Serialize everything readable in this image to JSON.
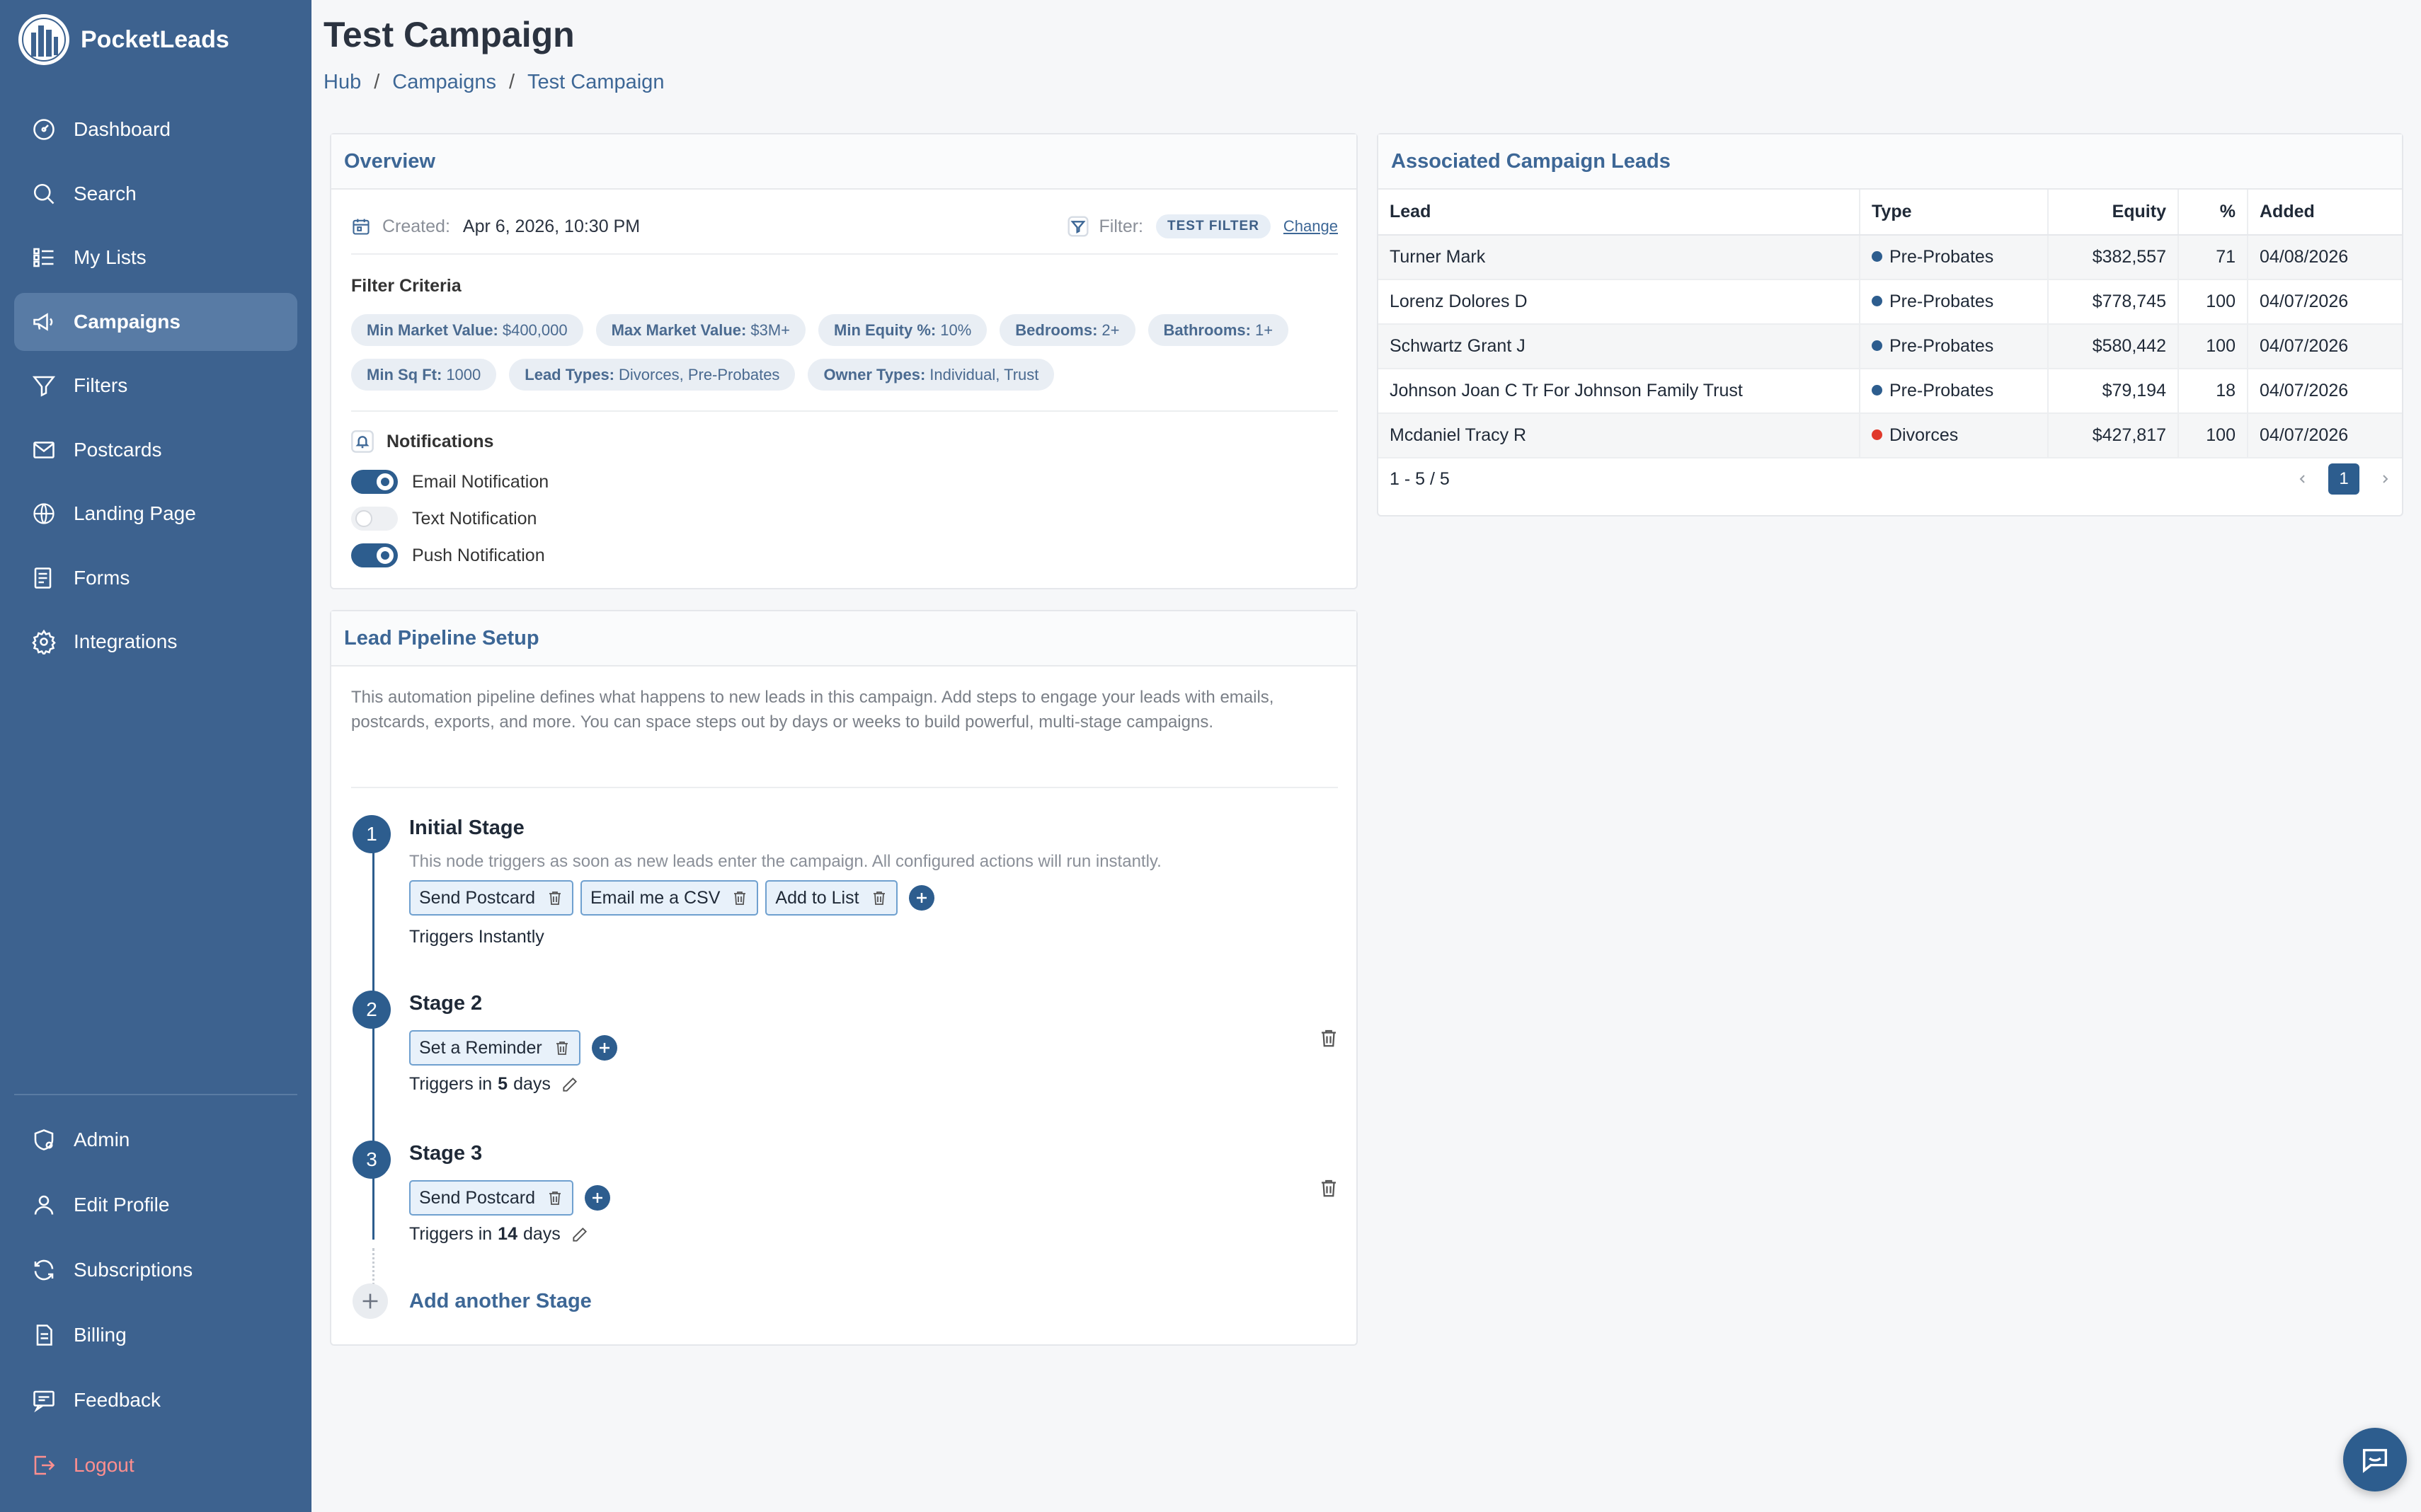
{
  "brand": {
    "name": "PocketLeads"
  },
  "nav": {
    "items": [
      {
        "label": "Dashboard",
        "icon": "dashboard-icon"
      },
      {
        "label": "Search",
        "icon": "search-icon"
      },
      {
        "label": "My Lists",
        "icon": "list-icon"
      },
      {
        "label": "Campaigns",
        "icon": "megaphone-icon",
        "active": true
      },
      {
        "label": "Filters",
        "icon": "filter-icon"
      },
      {
        "label": "Postcards",
        "icon": "envelope-icon"
      },
      {
        "label": "Landing Page",
        "icon": "www-icon"
      },
      {
        "label": "Forms",
        "icon": "form-icon"
      },
      {
        "label": "Integrations",
        "icon": "gear-icon"
      }
    ],
    "bottom": [
      {
        "label": "Admin",
        "icon": "shield-gear-icon"
      },
      {
        "label": "Edit Profile",
        "icon": "user-icon"
      },
      {
        "label": "Subscriptions",
        "icon": "refresh-icon"
      },
      {
        "label": "Billing",
        "icon": "invoice-icon"
      },
      {
        "label": "Feedback",
        "icon": "feedback-icon"
      },
      {
        "label": "Logout",
        "icon": "logout-icon"
      }
    ]
  },
  "page": {
    "title": "Test Campaign",
    "breadcrumb": [
      "Hub",
      "Campaigns",
      "Test Campaign"
    ],
    "breadcrumb_sep": "/"
  },
  "overview": {
    "title": "Overview",
    "created_label": "Created:",
    "created_value": "Apr 6, 2026, 10:30 PM",
    "filter_label": "Filter:",
    "filter_name": "TEST FILTER",
    "change_label": "Change",
    "criteria_title": "Filter Criteria",
    "criteria": [
      {
        "key": "Min Market Value:",
        "value": "$400,000"
      },
      {
        "key": "Max Market Value:",
        "value": "$3M+"
      },
      {
        "key": "Min Equity %:",
        "value": "10%"
      },
      {
        "key": "Bedrooms:",
        "value": "2+"
      },
      {
        "key": "Bathrooms:",
        "value": "1+"
      },
      {
        "key": "Min Sq Ft:",
        "value": "1000"
      },
      {
        "key": "Lead Types:",
        "value": "Divorces, Pre-Probates"
      },
      {
        "key": "Owner Types:",
        "value": "Individual, Trust"
      }
    ],
    "notifications_title": "Notifications",
    "notifications": [
      {
        "label": "Email Notification",
        "on": true
      },
      {
        "label": "Text Notification",
        "on": false
      },
      {
        "label": "Push Notification",
        "on": true
      }
    ]
  },
  "pipeline": {
    "title": "Lead Pipeline Setup",
    "description": "This automation pipeline defines what happens to new leads in this campaign. Add steps to engage your leads with emails, postcards, exports, and more. You can space steps out by days or weeks to build powerful, multi-stage campaigns.",
    "stages": [
      {
        "num": "1",
        "title": "Initial Stage",
        "subtitle": "This node triggers as soon as new leads enter the campaign. All configured actions will run instantly.",
        "actions": [
          "Send Postcard",
          "Email me a CSV",
          "Add to List"
        ],
        "trigger_text": "Triggers Instantly"
      },
      {
        "num": "2",
        "title": "Stage 2",
        "actions": [
          "Set a Reminder"
        ],
        "trigger_prefix": "Triggers in",
        "trigger_days": "5",
        "trigger_suffix": "days"
      },
      {
        "num": "3",
        "title": "Stage 3",
        "actions": [
          "Send Postcard"
        ],
        "trigger_prefix": "Triggers in",
        "trigger_days": "14",
        "trigger_suffix": "days"
      }
    ],
    "add_stage_label": "Add another Stage"
  },
  "leads": {
    "title": "Associated Campaign Leads",
    "columns": [
      "Lead",
      "Type",
      "Equity",
      "%",
      "Added"
    ],
    "rows": [
      {
        "lead": "Turner Mark",
        "type": "Pre-Probates",
        "type_color": "#2d5d8e",
        "equity": "$382,557",
        "pct": "71",
        "added": "04/08/2026"
      },
      {
        "lead": "Lorenz Dolores D",
        "type": "Pre-Probates",
        "type_color": "#2d5d8e",
        "equity": "$778,745",
        "pct": "100",
        "added": "04/07/2026"
      },
      {
        "lead": "Schwartz Grant J",
        "type": "Pre-Probates",
        "type_color": "#2d5d8e",
        "equity": "$580,442",
        "pct": "100",
        "added": "04/07/2026"
      },
      {
        "lead": "Johnson Joan C Tr For Johnson Family Trust",
        "type": "Pre-Probates",
        "type_color": "#2d5d8e",
        "equity": "$79,194",
        "pct": "18",
        "added": "04/07/2026"
      },
      {
        "lead": "Mcdaniel Tracy R",
        "type": "Divorces",
        "type_color": "#e0392b",
        "equity": "$427,817",
        "pct": "100",
        "added": "04/07/2026"
      }
    ],
    "range": "1 - 5 / 5",
    "current_page": "1"
  },
  "colors": {
    "sidebar": "#3d628f",
    "accent": "#2d5d8e",
    "logout": "#ff8f8f"
  }
}
